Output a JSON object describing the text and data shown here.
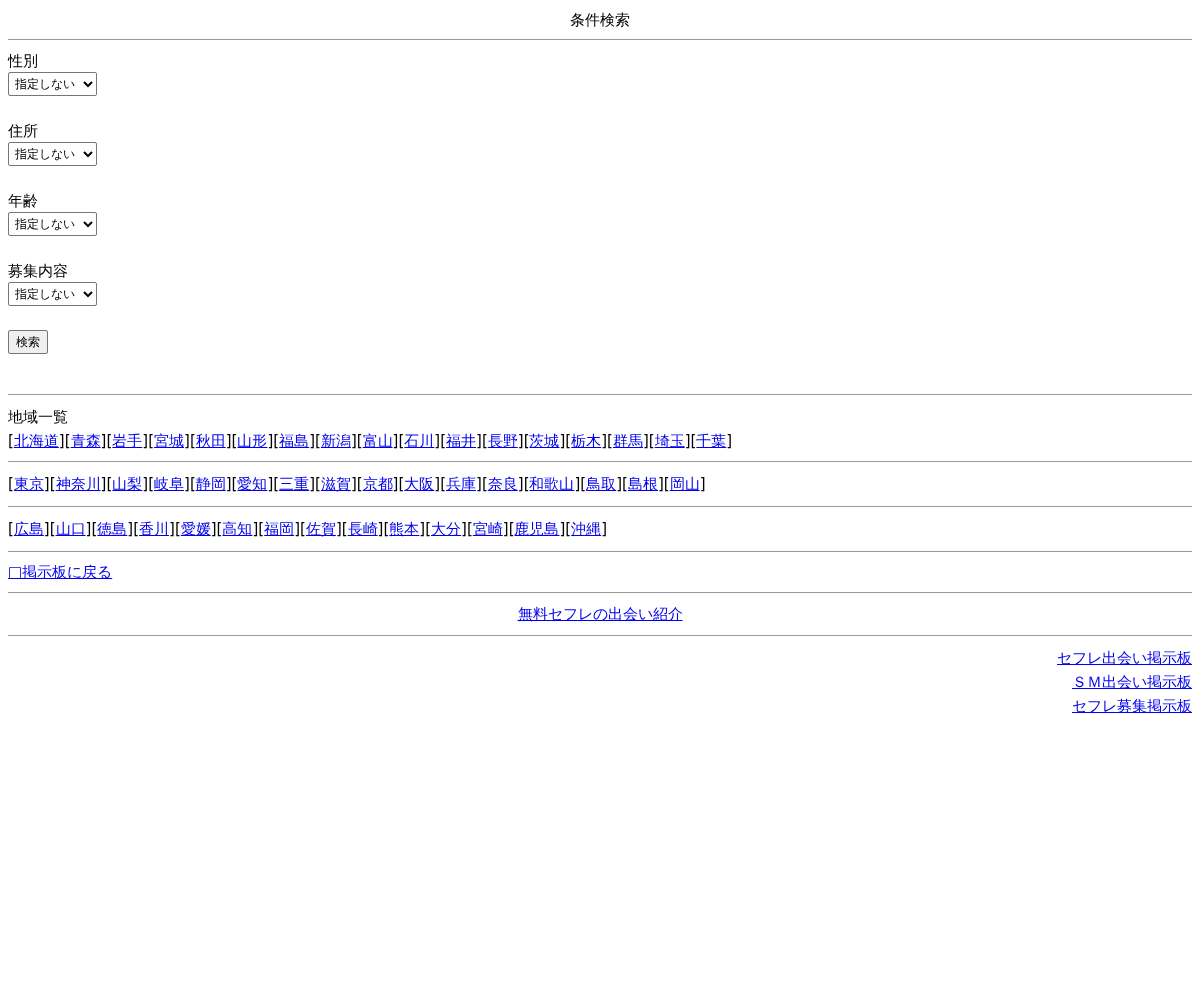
{
  "title": "条件検索",
  "filters": [
    {
      "label": "性別",
      "value": "指定しない"
    },
    {
      "label": "住所",
      "value": "指定しない"
    },
    {
      "label": "年齢",
      "value": "指定しない"
    },
    {
      "label": "募集内容",
      "value": "指定しない"
    }
  ],
  "search_button": "検索",
  "regions": {
    "heading": "地域一覧",
    "open_bracket": "[",
    "close_bracket": "]",
    "groups": [
      [
        "北海道",
        "青森",
        "岩手",
        "宮城",
        "秋田",
        "山形",
        "福島",
        "新潟",
        "富山",
        "石川",
        "福井",
        "長野",
        "茨城",
        "栃木",
        "群馬",
        "埼玉",
        "千葉"
      ],
      [
        "東京",
        "神奈川",
        "山梨",
        "岐阜",
        "静岡",
        "愛知",
        "三重",
        "滋賀",
        "京都",
        "大阪",
        "兵庫",
        "奈良",
        "和歌山",
        "鳥取",
        "島根",
        "岡山"
      ],
      [
        "広島",
        "山口",
        "徳島",
        "香川",
        "愛媛",
        "高知",
        "福岡",
        "佐賀",
        "長崎",
        "熊本",
        "大分",
        "宮崎",
        "鹿児島",
        "沖縄"
      ]
    ]
  },
  "back_link": "□掲示板に戻る",
  "center_link": "無料セフレの出会い紹介",
  "footer_links": [
    "セフレ出会い掲示板",
    "ＳＭ出会い掲示板",
    "セフレ募集掲示板"
  ]
}
